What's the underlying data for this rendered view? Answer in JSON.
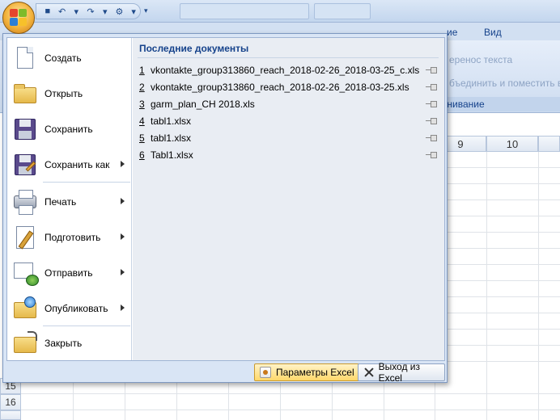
{
  "ribbon": {
    "tab_view": "Вид",
    "tab_partial": "ие",
    "wrap_text": "еренос текста",
    "merge_center": "бъединить и поместить в",
    "alignment_group": "внивание"
  },
  "sheet": {
    "columns": [
      "9",
      "10"
    ],
    "rows": [
      "15",
      "16"
    ]
  },
  "menu": {
    "items": [
      {
        "label": "Создать",
        "icon": "new-document-icon"
      },
      {
        "label": "Открыть",
        "icon": "open-folder-icon"
      },
      {
        "label": "Сохранить",
        "icon": "save-icon"
      },
      {
        "label": "Сохранить как",
        "icon": "save-as-icon"
      },
      {
        "label": "Печать",
        "icon": "printer-icon"
      },
      {
        "label": "Подготовить",
        "icon": "prepare-icon"
      },
      {
        "label": "Отправить",
        "icon": "send-icon"
      },
      {
        "label": "Опубликовать",
        "icon": "publish-icon"
      },
      {
        "label": "Закрыть",
        "icon": "close-folder-icon"
      }
    ],
    "recent_title": "Последние документы",
    "recent": [
      {
        "num": "1",
        "name": "vkontakte_group313860_reach_2018-02-26_2018-03-25_c.xls"
      },
      {
        "num": "2",
        "name": "vkontakte_group313860_reach_2018-02-26_2018-03-25.xls"
      },
      {
        "num": "3",
        "name": "garm_plan_CH 2018.xls"
      },
      {
        "num": "4",
        "name": "tabl1.xlsx"
      },
      {
        "num": "5",
        "name": "tabl1.xlsx"
      },
      {
        "num": "6",
        "name": "Tabl1.xlsx"
      }
    ],
    "options_label": "Параметры Excel",
    "exit_label": "Выход из Excel"
  }
}
